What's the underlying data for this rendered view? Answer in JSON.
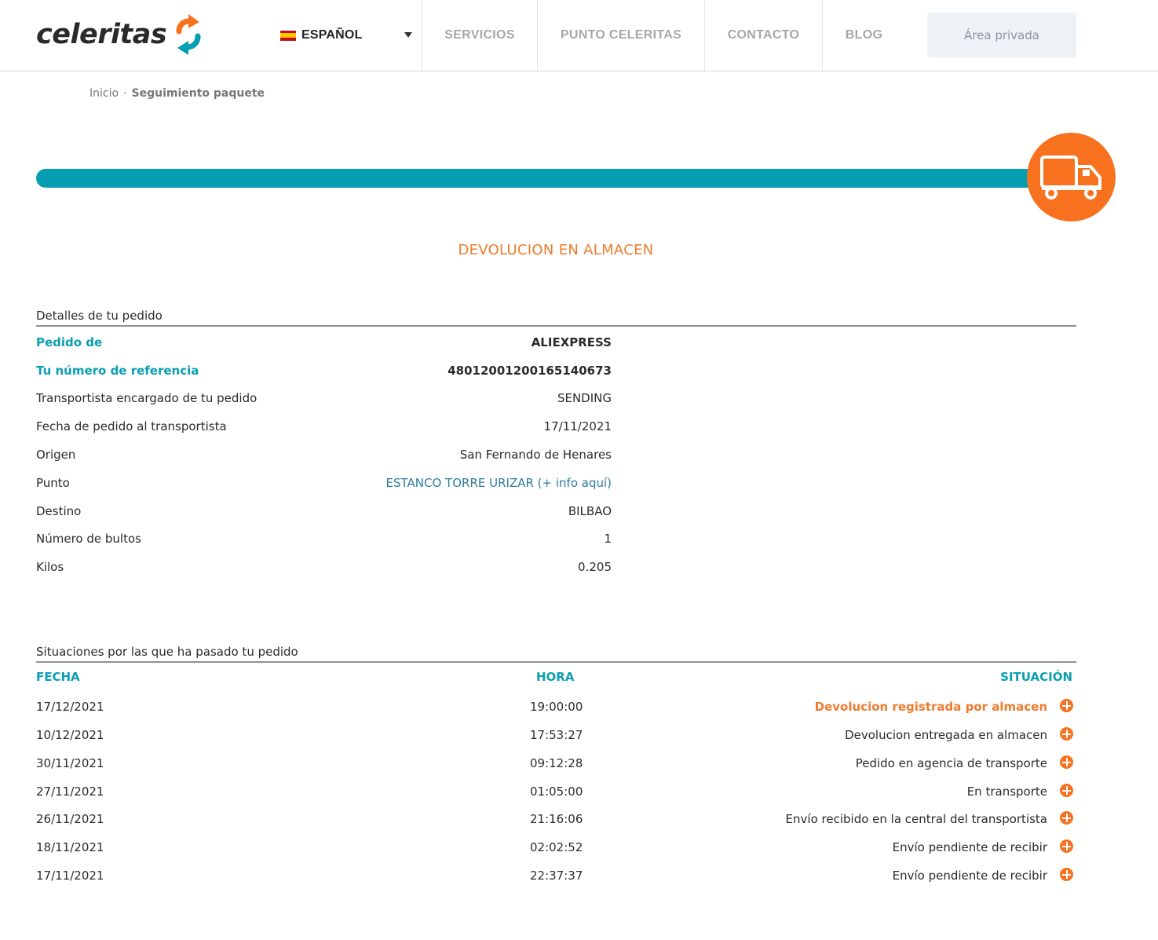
{
  "header": {
    "logo_text": "celeritas",
    "language": "ESPAÑOL",
    "nav": [
      "SERVICIOS",
      "PUNTO CELERITAS",
      "CONTACTO",
      "BLOG"
    ],
    "private_area": "Área privada"
  },
  "breadcrumb": {
    "home": "Inicio",
    "separator": "·",
    "current": "Seguimiento paquete"
  },
  "tracking": {
    "progress_fraction": 1.0,
    "status": "DEVOLUCION EN ALMACEN",
    "accent_color": "#049db2",
    "status_color": "#ef7b2d"
  },
  "details": {
    "title": "Detalles de tu pedido",
    "rows": [
      {
        "label": "Pedido de",
        "value": "ALIEXPRESS"
      },
      {
        "label": "Tu número de referencia",
        "value": "48012001200165140673"
      },
      {
        "label": "Transportista encargado de tu pedido",
        "value": "SENDING"
      },
      {
        "label": "Fecha de pedido al transportista",
        "value": "17/11/2021"
      },
      {
        "label": "Origen",
        "value": "San Fernando de Henares"
      },
      {
        "label": "Punto",
        "value": "ESTANCO TORRE URIZAR (+ info aquí)"
      },
      {
        "label": "Destino",
        "value": "BILBAO"
      },
      {
        "label": "Número de bultos",
        "value": "1"
      },
      {
        "label": "Kilos",
        "value": "0.205"
      }
    ]
  },
  "history": {
    "title": "Situaciones por las que ha pasado tu pedido",
    "columns": {
      "fecha": "FECHA",
      "hora": "HORA",
      "situacion": "SITUACIÓN"
    },
    "rows": [
      {
        "fecha": "17/12/2021",
        "hora": "19:00:00",
        "situacion": "Devolucion registrada por almacen"
      },
      {
        "fecha": "10/12/2021",
        "hora": "17:53:27",
        "situacion": "Devolucion entregada en almacen"
      },
      {
        "fecha": "30/11/2021",
        "hora": "09:12:28",
        "situacion": "Pedido en agencia de transporte"
      },
      {
        "fecha": "27/11/2021",
        "hora": "01:05:00",
        "situacion": "En transporte"
      },
      {
        "fecha": "26/11/2021",
        "hora": "21:16:06",
        "situacion": "Envío recibido en la central del transportista"
      },
      {
        "fecha": "18/11/2021",
        "hora": "02:02:52",
        "situacion": "Envío pendiente de recibir"
      },
      {
        "fecha": "17/11/2021",
        "hora": "22:37:37",
        "situacion": "Envío pendiente de recibir"
      }
    ]
  }
}
